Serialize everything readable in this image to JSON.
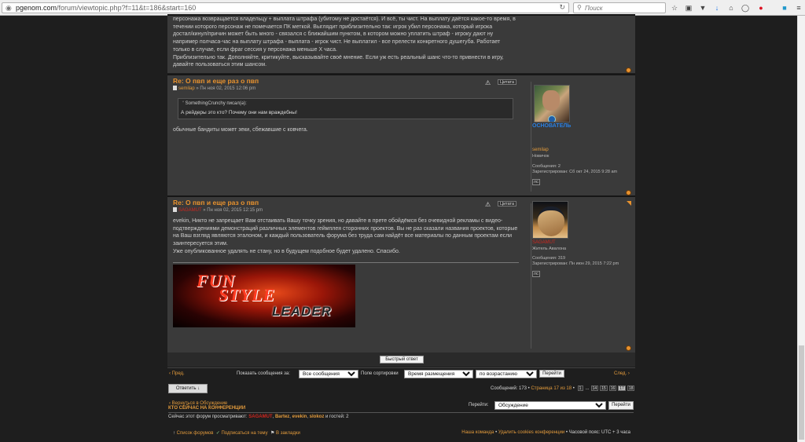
{
  "browser": {
    "url_host": "pgenom.com",
    "url_path": "/forum/viewtopic.php?f=11&t=186&start=160",
    "search_placeholder": "Поиск"
  },
  "colors": {
    "accent": "#e39b3c",
    "post_bg": "#3a3a3a",
    "page_bg": "#1e1e1e",
    "rank_admin": "#2b7fe0",
    "moderator": "#e0362b"
  },
  "post0": {
    "lines": [
      "персонажа возвращается владельцу + выплата штрафа (убитому не достаётся). И всё, ты чист. На выплату даётся какое-то время, в",
      "течении которого персонаж не помечается ПК меткой. Выглядит приблизительно так: игрок убил персонажа, который игрока",
      "достал/кинул/причин может быть много - связался с ближайшим пунктом, в котором можно уплатить штраф - игроку дают ну",
      "например полчаса-час на выплату штрафа - выплата - игрок чист. Не выплатил - все прелести конкретного душегуба. Работает",
      "только в случае, если фраг сессия у персонажа меньше X часа.",
      "Приблизительно так. Дополняйте, критикуйте, высказывайте своё мнение. Если уж есть реальный шанс что-то привнести в игру,",
      "давайте пользоваться этим шансом."
    ]
  },
  "post1": {
    "title": "Re: О пвп и еще раз о пвп",
    "author": "semilap",
    "date": "» Пн ноя 02, 2015 12:06 pm",
    "quote_btn": "Цитата",
    "quote_author": "SomethingCrunchy писал(а):",
    "quote_text": "А рейдеры это кто? Почему они нам враждебны!",
    "text": "обычные бандиты может зеки, сбежавшие с ковчега.",
    "rank": "ОСНОВАТЕЛЬ",
    "prof_name": "semilap",
    "prof_rank": "Новичок",
    "posts": "Сообщения: 2",
    "registered": "Зарегистрирован: Сб окт 24, 2015 9:28 am",
    "pm": "ЛС"
  },
  "post2": {
    "title": "Re: О пвп и еще раз о пвп",
    "author": "SAGAMUT",
    "date": "» Пн ноя 02, 2015 12:15 pm",
    "quote_btn": "Цитата",
    "lines": [
      "evekin, Никто не запрещает Вам отстаивать Вашу точку зрения, но давайте в прете обойдёмся без очевидной рекламы с видео-",
      "подтверждениями демонстраций различных элементов геймплея сторонних проектов. Вы не раз сказали названия проектов, которые",
      "на Ваш взгляд являются эталоном, и каждый пользователь форума без труда сам найдёт все материалы по данным проектам если",
      "заинтересуется этим.",
      "Уже опубликованное удалять не стану, но в будущем подобное будет удалено. Спасибо."
    ],
    "banner": [
      "FUN",
      "STYLE",
      "LEADER"
    ],
    "prof_name": "SAGAMUT",
    "prof_rank": "Житель Авалона",
    "posts": "Сообщения: 319",
    "registered": "Зарегистрирован: Пн июн 29, 2015 7:22 pm",
    "pm": "ЛС"
  },
  "quick_reply": "Быстрый ответ",
  "sortbar": {
    "prev": "Пред.",
    "show_label": "Показать сообщения за:",
    "show_value": "Все сообщения",
    "sort_label": "Поле сортировки",
    "sort_value": "Время размещения",
    "order_value": "по возрастанию",
    "go": "Перейти",
    "next": "След."
  },
  "reply": "Ответить",
  "pagination": {
    "summary": "Сообщений: 173 •",
    "page_label": "Страница 17 из 18",
    "sep": "•",
    "pages": [
      "1",
      "...",
      "14",
      "15",
      "16",
      "17",
      "18"
    ],
    "current": "17"
  },
  "return_link": "Вернуться в Обсуждение",
  "jump": {
    "label": "Перейти:",
    "value": "Обсуждение",
    "button": "Перейти"
  },
  "online": {
    "heading": "КТО СЕЙЧАС НА КОНФЕРЕНЦИИ",
    "prefix": "Сейчас этот форум просматривают:",
    "users": [
      "SAGAMUT",
      ", ",
      "Bartez",
      ", ",
      "evekin",
      ", ",
      "slokoz"
    ],
    "suffix": "и гостей: 2"
  },
  "footer": {
    "index": "Список форумов",
    "subscribe": "Подписаться на тему",
    "bookmark": "В закладки",
    "team": "Наша команда",
    "cookies": "Удалить cookies конференции",
    "sep": "•",
    "tz": "Часовой пояс: UTC + 3 часа"
  }
}
